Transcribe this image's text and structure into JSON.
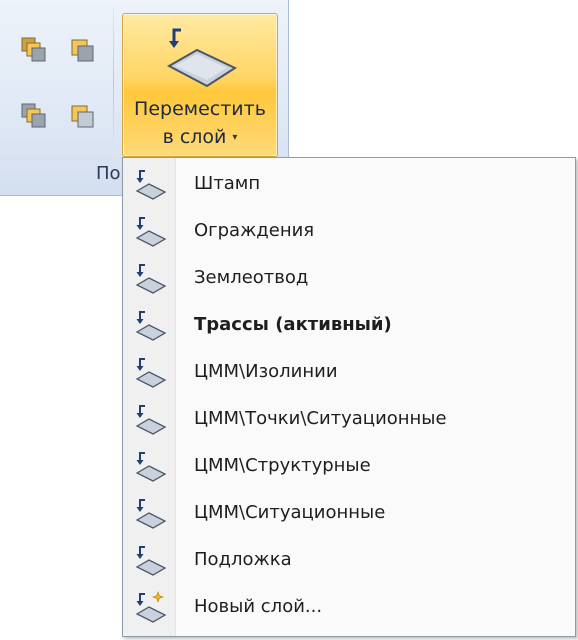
{
  "ribbon": {
    "move_to_layer": {
      "line1": "Переместить",
      "line2": "в слой",
      "arrow": "▾"
    },
    "group_label": "По",
    "small_buttons": [
      "bring-forward-icon",
      "send-backward-icon",
      "bring-to-front-icon",
      "send-to-back-icon"
    ]
  },
  "menu": {
    "items": [
      {
        "label": "Штамп",
        "bold": false,
        "icon": "move-to-layer-icon"
      },
      {
        "label": "Ограждения",
        "bold": false,
        "icon": "move-to-layer-icon"
      },
      {
        "label": "Землеотвод",
        "bold": false,
        "icon": "move-to-layer-icon"
      },
      {
        "label": "Трассы (активный)",
        "bold": true,
        "icon": "move-to-layer-icon"
      },
      {
        "label": "ЦММ\\Изолинии",
        "bold": false,
        "icon": "move-to-layer-icon"
      },
      {
        "label": "ЦММ\\Точки\\Ситуационные",
        "bold": false,
        "icon": "move-to-layer-icon"
      },
      {
        "label": "ЦММ\\Структурные",
        "bold": false,
        "icon": "move-to-layer-icon"
      },
      {
        "label": "ЦММ\\Ситуационные",
        "bold": false,
        "icon": "move-to-layer-icon"
      },
      {
        "label": "Подложка",
        "bold": false,
        "icon": "move-to-layer-icon"
      },
      {
        "label": "Новый слой...",
        "bold": false,
        "icon": "new-layer-icon"
      }
    ]
  },
  "colors": {
    "ribbon_bg": "#dfe8f5",
    "highlight": "#ffd566",
    "layer_fill": "#b9c3d1",
    "arrow": "#1f3f7a"
  }
}
